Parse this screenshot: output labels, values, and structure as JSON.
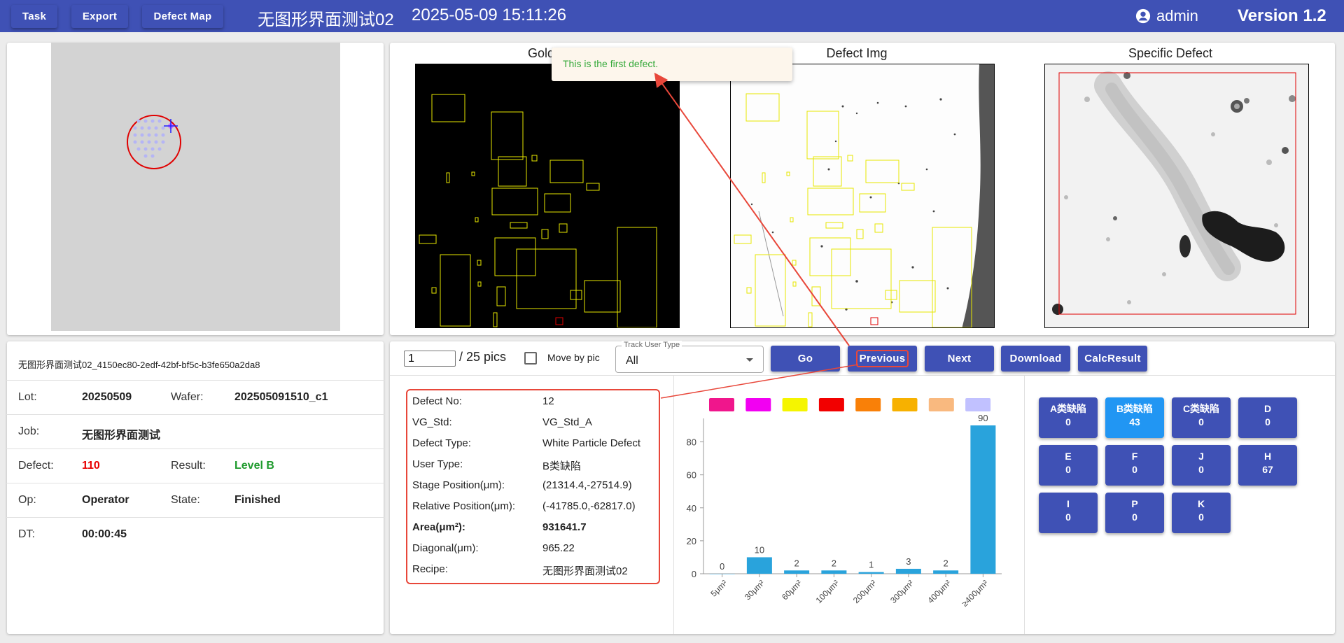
{
  "toolbar": {
    "task": "Task",
    "export": "Export",
    "defect_map": "Defect Map",
    "title": "无图形界面测试02",
    "datetime": "2025-05-09 15:11:26",
    "user": "admin",
    "version": "Version 1.2"
  },
  "images": {
    "golden_title": "Golden",
    "defect_title": "Defect Img",
    "specific_title": "Specific Defect",
    "tooltip": "This is the first defect."
  },
  "info": {
    "id": "无图形界面测试02_4150ec80-2edf-42bf-bf5c-b3fe650a2da8",
    "lot_label": "Lot:",
    "lot": "20250509",
    "wafer_label": "Wafer:",
    "wafer": "202505091510_c1",
    "job_label": "Job:",
    "job": "无图形界面测试",
    "defect_label": "Defect:",
    "defect": "110",
    "result_label": "Result:",
    "result": "Level B",
    "op_label": "Op:",
    "op": "Operator",
    "state_label": "State:",
    "state": "Finished",
    "dt_label": "DT:",
    "dt": "00:00:45"
  },
  "controls": {
    "page_value": "1",
    "page_total": "/ 25 pics",
    "move_by_pic": "Move by pic",
    "track_legend": "Track User Type",
    "track_value": "All",
    "go": "Go",
    "previous": "Previous",
    "next": "Next",
    "download": "Download",
    "calc": "CalcResult"
  },
  "details": [
    {
      "label": "Defect No:",
      "value": "12"
    },
    {
      "label": "VG_Std:",
      "value": "VG_Std_A"
    },
    {
      "label": "Defect Type:",
      "value": "White Particle Defect"
    },
    {
      "label": "User Type:",
      "value": "B类缺陷"
    },
    {
      "label": "Stage Position(μm):",
      "value": "(21314.4,-27514.9)"
    },
    {
      "label": "Relative Position(μm):",
      "value": "(-41785.0,-62817.0)"
    },
    {
      "label": "Area(μm²):",
      "value": "931641.7"
    },
    {
      "label": "Diagonal(μm):",
      "value": "965.22"
    },
    {
      "label": "Recipe:",
      "value": "无图形界面测试02"
    }
  ],
  "chart_data": {
    "type": "bar",
    "categories": [
      "5μm²",
      "30μm²",
      "60μm²",
      "100μm²",
      "200μm²",
      "300μm²",
      "400μm²",
      "≥400μm²"
    ],
    "values": [
      0,
      10,
      2,
      2,
      1,
      3,
      2,
      90
    ],
    "ylim": [
      0,
      90
    ],
    "yticks": [
      0,
      20,
      40,
      60,
      80
    ],
    "bar_color": "#29a3dc",
    "legend_colors": [
      "#f0168c",
      "#f200f2",
      "#f5f500",
      "#f20000",
      "#f98008",
      "#f7b100",
      "#f9b97f",
      "#c1c1ff"
    ],
    "grid": false
  },
  "categories_buttons": [
    {
      "name": "A类缺陷",
      "count": "0"
    },
    {
      "name": "B类缺陷",
      "count": "43",
      "active": true
    },
    {
      "name": "C类缺陷",
      "count": "0"
    },
    {
      "name": "D",
      "count": "0"
    },
    {
      "name": "E",
      "count": "0"
    },
    {
      "name": "F",
      "count": "0"
    },
    {
      "name": "J",
      "count": "0"
    },
    {
      "name": "H",
      "count": "67"
    },
    {
      "name": "I",
      "count": "0"
    },
    {
      "name": "P",
      "count": "0"
    },
    {
      "name": "K",
      "count": "0"
    }
  ]
}
